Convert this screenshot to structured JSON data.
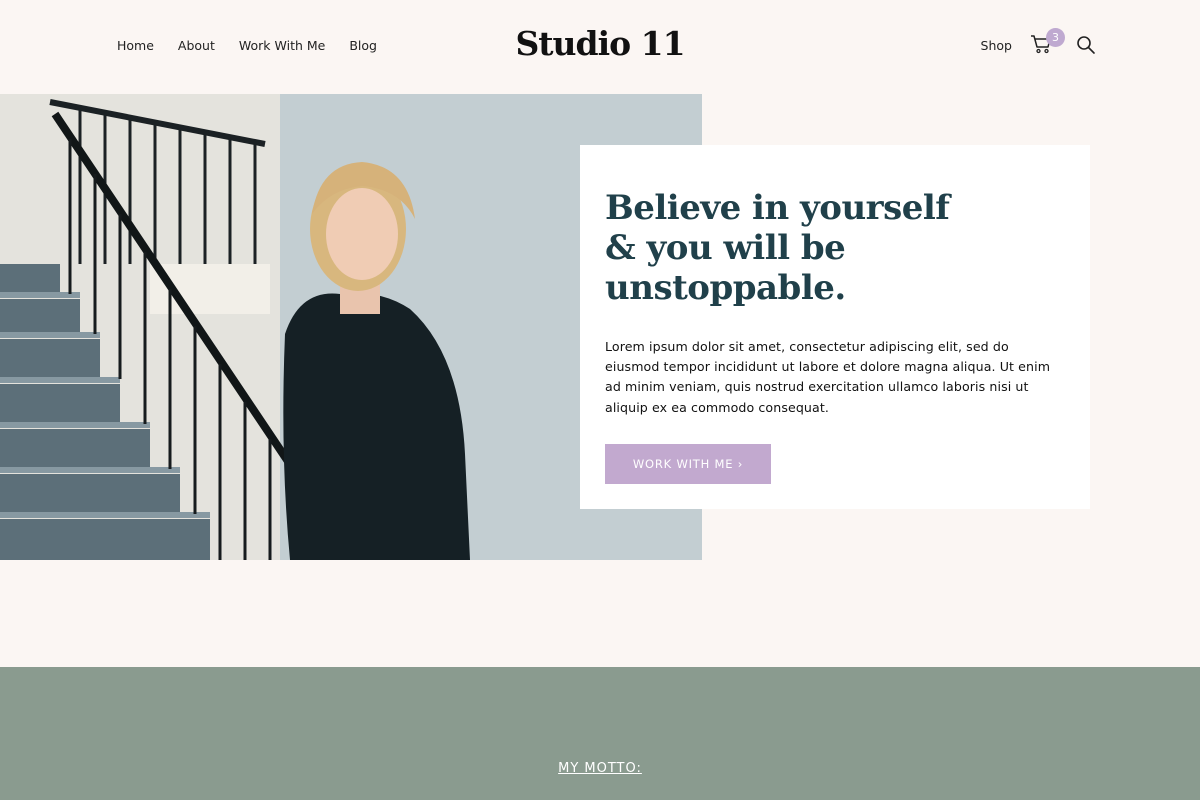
{
  "header": {
    "brand": "Studio 11",
    "nav_left": [
      "Home",
      "About",
      "Work With Me",
      "Blog"
    ],
    "shop_label": "Shop",
    "cart_count": "3"
  },
  "hero": {
    "headline_lines": [
      "Believe in yourself",
      "& you will be",
      "unstoppable."
    ],
    "body": "Lorem ipsum dolor sit amet, consectetur adipiscing elit, sed do eiusmod tempor incididunt ut labore et dolore magna aliqua. Ut enim ad minim veniam, quis nostrud exercitation ullamco laboris nisi ut aliquip ex ea commodo consequat.",
    "cta_label": "WORK WITH ME ›"
  },
  "motto": {
    "label": "MY MOTTO:"
  },
  "colors": {
    "background": "#fbf6f3",
    "headline": "#20404a",
    "button": "#c2a9cf",
    "band": "#8a9b8f"
  }
}
